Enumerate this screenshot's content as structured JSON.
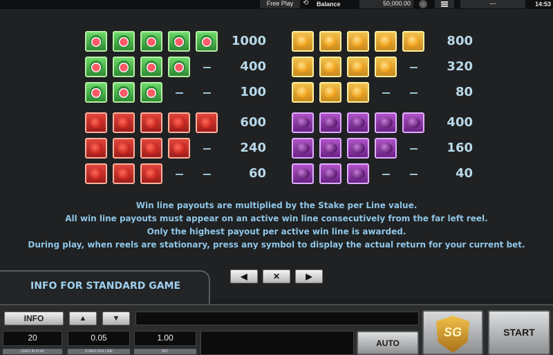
{
  "topbar": {
    "free_play": "Free Play",
    "balance_label": "Balance",
    "balance_value": "50,000.00",
    "extra": "---",
    "time": "14:53"
  },
  "paytable": {
    "left": [
      {
        "symbol": "watermelon",
        "count": 5,
        "payout": "1000"
      },
      {
        "symbol": "watermelon",
        "count": 4,
        "payout": "400"
      },
      {
        "symbol": "watermelon",
        "count": 3,
        "payout": "100"
      },
      {
        "symbol": "strawberry",
        "count": 5,
        "payout": "600"
      },
      {
        "symbol": "strawberry",
        "count": 4,
        "payout": "240"
      },
      {
        "symbol": "strawberry",
        "count": 3,
        "payout": "60"
      }
    ],
    "right": [
      {
        "symbol": "orange",
        "count": 5,
        "payout": "800"
      },
      {
        "symbol": "orange",
        "count": 4,
        "payout": "320"
      },
      {
        "symbol": "orange",
        "count": 3,
        "payout": "80"
      },
      {
        "symbol": "plum",
        "count": 5,
        "payout": "400"
      },
      {
        "symbol": "plum",
        "count": 4,
        "payout": "160"
      },
      {
        "symbol": "plum",
        "count": 3,
        "payout": "40"
      }
    ]
  },
  "rules": [
    "Win line payouts are multiplied by the Stake per Line value.",
    "All win line payouts must appear on an active win line consecutively from the far left reel.",
    "Only the highest payout per active win line is awarded.",
    "During play, when reels are stationary, press any symbol to display the actual return for your current bet."
  ],
  "info_tab": "INFO FOR STANDARD GAME",
  "nav": {
    "prev": "◀",
    "close": "✕",
    "next": "▶"
  },
  "controls": {
    "info": "INFO",
    "lines_value": "20",
    "lines_label": "LINES IN PLAY",
    "stake_value": "0.05",
    "stake_label": "STAKE PER LINE",
    "bet_value": "1.00",
    "bet_label": "BET",
    "auto": "AUTO",
    "logo": "SG",
    "start": "START"
  }
}
